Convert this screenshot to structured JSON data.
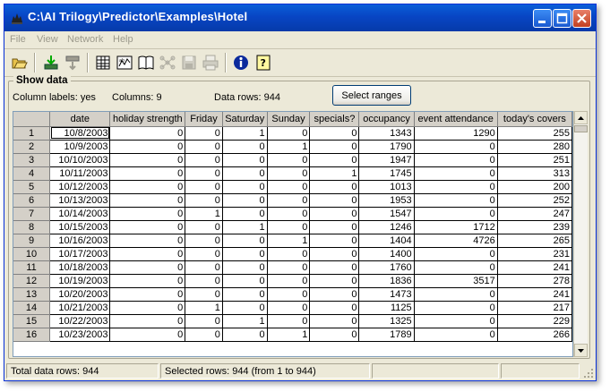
{
  "window": {
    "title": "C:\\AI Trilogy\\Predictor\\Examples\\Hotel"
  },
  "menu": [
    "File",
    "View",
    "Network",
    "Help"
  ],
  "toolbar_icons": [
    "open-folder-icon",
    "import-icon",
    "export-icon",
    "data-grid-icon",
    "train-icon",
    "book-icon",
    "network-icon",
    "save-icon",
    "print-icon",
    "info-icon",
    "help-icon"
  ],
  "group": {
    "title": "Show data",
    "column_labels": "Column labels:  yes",
    "columns": "Columns:  9",
    "data_rows": "Data rows: 944",
    "select_ranges": "Select ranges"
  },
  "table": {
    "headers": [
      "date",
      "holiday strength",
      "Friday",
      "Saturday",
      "Sunday",
      "specials?",
      "occupancy",
      "event attendance",
      "today's covers"
    ],
    "rows": [
      {
        "n": "1",
        "cells": [
          "10/8/2003",
          "0",
          "0",
          "1",
          "0",
          "0",
          "1343",
          "1290",
          "255"
        ]
      },
      {
        "n": "2",
        "cells": [
          "10/9/2003",
          "0",
          "0",
          "0",
          "1",
          "0",
          "1790",
          "0",
          "280"
        ]
      },
      {
        "n": "3",
        "cells": [
          "10/10/2003",
          "0",
          "0",
          "0",
          "0",
          "0",
          "1947",
          "0",
          "251"
        ]
      },
      {
        "n": "4",
        "cells": [
          "10/11/2003",
          "0",
          "0",
          "0",
          "0",
          "1",
          "1745",
          "0",
          "313"
        ]
      },
      {
        "n": "5",
        "cells": [
          "10/12/2003",
          "0",
          "0",
          "0",
          "0",
          "0",
          "1013",
          "0",
          "200"
        ]
      },
      {
        "n": "6",
        "cells": [
          "10/13/2003",
          "0",
          "0",
          "0",
          "0",
          "0",
          "1953",
          "0",
          "252"
        ]
      },
      {
        "n": "7",
        "cells": [
          "10/14/2003",
          "0",
          "1",
          "0",
          "0",
          "0",
          "1547",
          "0",
          "247"
        ]
      },
      {
        "n": "8",
        "cells": [
          "10/15/2003",
          "0",
          "0",
          "1",
          "0",
          "0",
          "1246",
          "1712",
          "239"
        ]
      },
      {
        "n": "9",
        "cells": [
          "10/16/2003",
          "0",
          "0",
          "0",
          "1",
          "0",
          "1404",
          "4726",
          "265"
        ]
      },
      {
        "n": "10",
        "cells": [
          "10/17/2003",
          "0",
          "0",
          "0",
          "0",
          "0",
          "1400",
          "0",
          "231"
        ]
      },
      {
        "n": "11",
        "cells": [
          "10/18/2003",
          "0",
          "0",
          "0",
          "0",
          "0",
          "1760",
          "0",
          "241"
        ]
      },
      {
        "n": "12",
        "cells": [
          "10/19/2003",
          "0",
          "0",
          "0",
          "0",
          "0",
          "1836",
          "3517",
          "278"
        ]
      },
      {
        "n": "13",
        "cells": [
          "10/20/2003",
          "0",
          "0",
          "0",
          "0",
          "0",
          "1473",
          "0",
          "241"
        ]
      },
      {
        "n": "14",
        "cells": [
          "10/21/2003",
          "0",
          "1",
          "0",
          "0",
          "0",
          "1125",
          "0",
          "217"
        ]
      },
      {
        "n": "15",
        "cells": [
          "10/22/2003",
          "0",
          "0",
          "1",
          "0",
          "0",
          "1325",
          "0",
          "229"
        ]
      },
      {
        "n": "16",
        "cells": [
          "10/23/2003",
          "0",
          "0",
          "0",
          "1",
          "0",
          "1789",
          "0",
          "266"
        ]
      }
    ]
  },
  "status": {
    "total": "Total data rows: 944",
    "selected": "Selected rows: 944  (from 1 to 944)"
  }
}
